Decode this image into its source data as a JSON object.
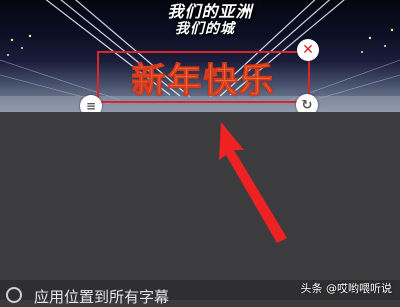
{
  "video": {
    "lyric_line_1": "我们的亚洲",
    "lyric_line_2": "我们的城"
  },
  "sticker": {
    "text": "新年快乐",
    "border_color": "#d9262b",
    "text_color": "#ff9e4a",
    "close_icon": "close-icon",
    "rotate_icon": "rotate-icon",
    "menu_icon": "menu-icon"
  },
  "annotation": {
    "arrow_color": "#ee2222"
  },
  "bottom_bar": {
    "label": "应用位置到所有字幕"
  },
  "watermark": {
    "text": "头条 @哎哟喂听说"
  }
}
